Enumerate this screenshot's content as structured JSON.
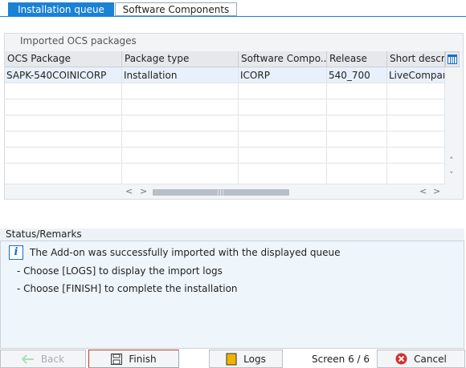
{
  "tabs": [
    {
      "label": "Installation queue",
      "active": true
    },
    {
      "label": "Software Components",
      "active": false
    }
  ],
  "panel": {
    "title": "Imported OCS packages",
    "columns": [
      "OCS Package",
      "Package type",
      "Software Compo...",
      "Release",
      "Short descrip"
    ],
    "rows": [
      [
        "SAPK-540COINICORP",
        "Installation",
        "ICORP",
        "540_700",
        "LiveCompare"
      ]
    ]
  },
  "status": {
    "title": "Status/Remarks",
    "messages": [
      "The Add-on was successfully imported with the displayed queue",
      "- Choose [LOGS] to display the import logs",
      "- Choose [FINISH] to complete the installation"
    ]
  },
  "footer": {
    "back_label": "Back",
    "finish_label": "Finish",
    "logs_label": "Logs",
    "screen_label": "Screen 6 / 6",
    "cancel_label": "Cancel"
  },
  "colors": {
    "accent": "#1a82d4",
    "cancel_icon": "#d0312d",
    "logs_icon": "#f0b400"
  }
}
